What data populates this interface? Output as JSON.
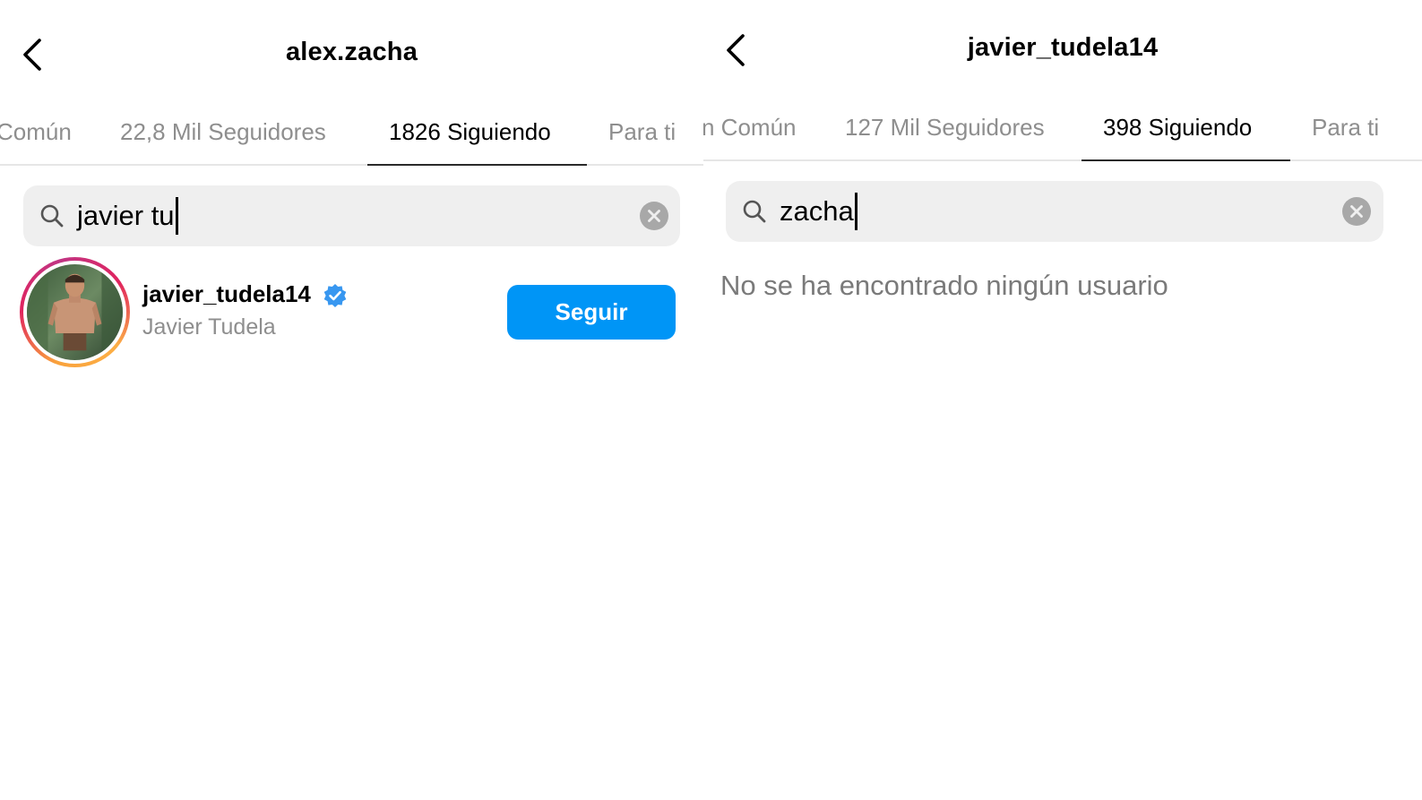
{
  "left": {
    "header": {
      "title": "alex.zacha",
      "back_icon": "chevron-left-icon"
    },
    "tabs": [
      {
        "label": "Común",
        "active": false
      },
      {
        "label": "22,8 Mil Seguidores",
        "active": false
      },
      {
        "label": "1826 Siguiendo",
        "active": true
      },
      {
        "label": "Para ti",
        "active": false
      }
    ],
    "search": {
      "value": "javier tu",
      "search_icon": "search-icon",
      "clear_icon": "clear-icon"
    },
    "results": [
      {
        "username": "javier_tudela14",
        "full_name": "Javier Tudela",
        "verified": true,
        "button_label": "Seguir"
      }
    ]
  },
  "right": {
    "header": {
      "title": "javier_tudela14",
      "back_icon": "chevron-left-icon"
    },
    "tabs": [
      {
        "label": "n Común",
        "active": false
      },
      {
        "label": "127 Mil Seguidores",
        "active": false
      },
      {
        "label": "398 Siguiendo",
        "active": true
      },
      {
        "label": "Para ti",
        "active": false
      }
    ],
    "search": {
      "value": "zacha",
      "search_icon": "search-icon",
      "clear_icon": "clear-icon"
    },
    "empty_message": "No se ha encontrado ningún usuario"
  },
  "colors": {
    "follow_button": "#0095f6",
    "verified_badge": "#3897f0",
    "muted_text": "#8e8e8e",
    "search_bg": "#efefef"
  }
}
